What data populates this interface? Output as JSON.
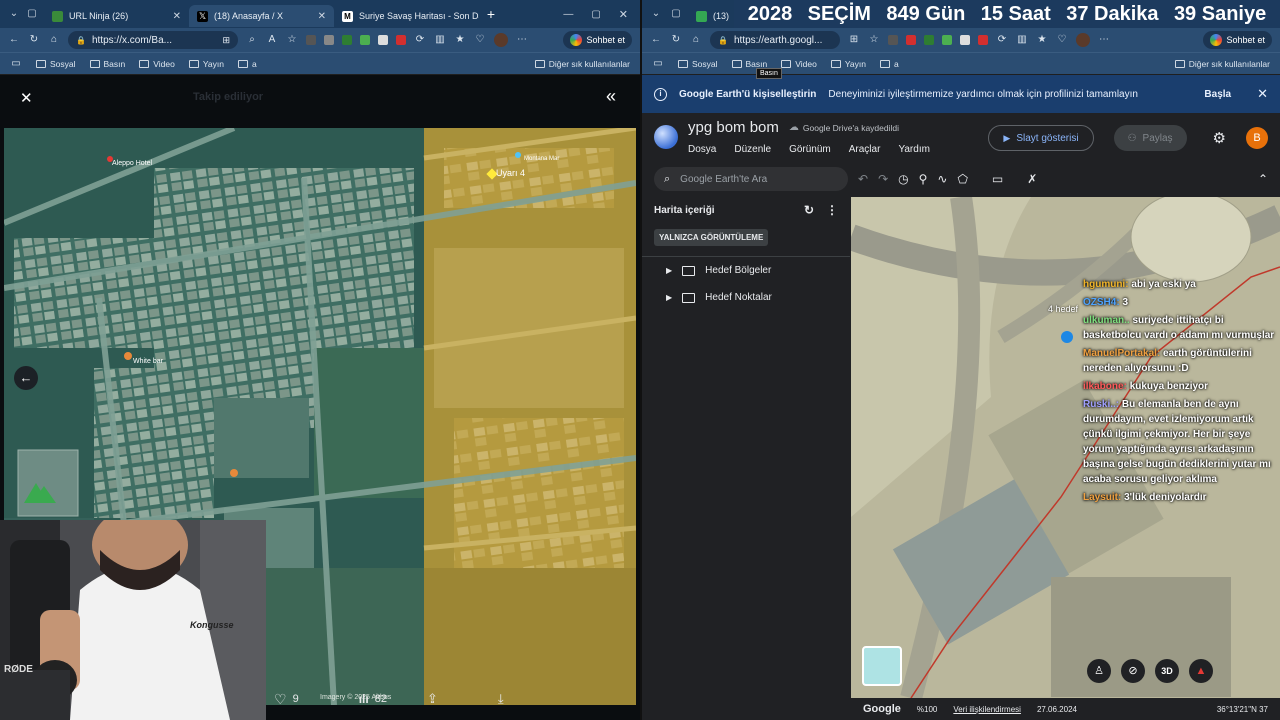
{
  "left_window": {
    "tabs": [
      {
        "label": "URL Ninja (26)",
        "active": false
      },
      {
        "label": "(18) Anasayfa / X",
        "active": true
      },
      {
        "label": "Suriye Savaş Haritası - Son Dak",
        "active": false
      }
    ],
    "url": "https://x.com/Ba...",
    "chat_button": "Sohbet et",
    "bookmarks": [
      "Sosyal",
      "Basın",
      "Video",
      "Yayın",
      "a"
    ],
    "bookmarks_other": "Diğer sık kullanılanlar",
    "faded_header": "Takip ediliyor",
    "map_labels": {
      "hotel": "Aleppo Hotel",
      "white": "White bar",
      "montana": "Montana Mar",
      "uyari": "Uyarı 4",
      "credit": "Imagery © 2025 Airbus"
    },
    "likes": "9",
    "views": "82"
  },
  "right_window": {
    "tabs": [
      {
        "label": "(13)",
        "active": false
      }
    ],
    "url": "https://earth.googl...",
    "chat_button": "Sohbet et",
    "bookmarks": [
      "Sosyal",
      "Basın",
      "Video",
      "Yayın",
      "a"
    ],
    "bookmarks_other": "Diğer sık kullanılanlar",
    "tooltip": "Basın"
  },
  "countdown": [
    "2028",
    "SEÇİM",
    "849 Gün",
    "15 Saat",
    "37 Dakika",
    "39 Saniye"
  ],
  "earth": {
    "banner_title": "Google Earth'ü kişiselleştirin",
    "banner_text": "Deneyiminizi iyileştirmemize yardımcı olmak için profilinizi tamamlayın",
    "banner_action": "Başla",
    "project_title": "ypg bom bom",
    "drive_status": "Google Drive'a kaydedildi",
    "menu": [
      "Dosya",
      "Düzenle",
      "Görünüm",
      "Araçlar",
      "Yardım"
    ],
    "slideshow": "Slayt gösterisi",
    "share": "Paylaş",
    "avatar": "B",
    "search_placeholder": "Google Earth'te Ara",
    "sidebar_title": "Harita içeriği",
    "view_only": "YALNIZCA GÖRÜNTÜLEME",
    "folders": [
      "Hedef Bölgeler",
      "Hedef Noktalar"
    ],
    "pin_label": "4 hedef",
    "status": {
      "logo": "Google",
      "zoom": "%100",
      "data": "Veri ilişkilendirmesi",
      "date": "27.06.2024",
      "coords": "36°13'21\"N 37"
    },
    "view3d": "3D"
  },
  "chat_messages": [
    {
      "user": "hgumuni:",
      "color": "#f0b429",
      "text": "abi ya eski ya"
    },
    {
      "user": "OZSH4:",
      "color": "#4da3ff",
      "text": "3"
    },
    {
      "user": "ulkuman..",
      "color": "#7fe07f",
      "text": "suriyede ittihatçı bi basketbolcu vardı o adamı mı vurmuşlar"
    },
    {
      "user": "ManuelPortakal:",
      "color": "#f0a040",
      "text": "earth görüntülerini nereden alıyorsunu :D"
    },
    {
      "user": "ilkabone:",
      "color": "#ff5a5a",
      "text": "kukuya benziyor"
    },
    {
      "user": "Ruski..:",
      "color": "#a0a0ff",
      "text": "Bu elemanla ben de aynı durumdayım, evet izlemiyorum artık çünkü ilgimi çekmiyor. Her bir şeye yorum yaptığında ayrısı arkadaşının başına gelse bugün dediklerini yutar mı acaba sorusu geliyor aklıma"
    },
    {
      "user": "Laysuit:",
      "color": "#f0a040",
      "text": "3'lük deniyolardır"
    }
  ],
  "webcam": {
    "shirt_text": "Kongusse",
    "brand": "RØDE"
  },
  "colors": {
    "tabbar": "#1b3a5c",
    "toolbar": "#2b4d72",
    "earth_banner": "#1a3e6e",
    "accent": "#8ab4f8"
  }
}
